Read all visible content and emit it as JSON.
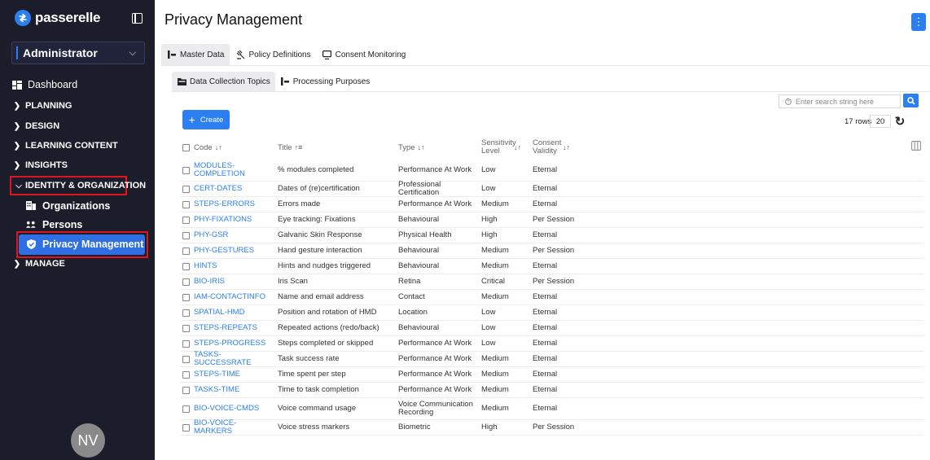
{
  "sidebar": {
    "brand": "passerelle",
    "role": "Administrator",
    "nav": {
      "dashboard": "Dashboard",
      "planning": "PLANNING",
      "design": "DESIGN",
      "learning_content": "LEARNING CONTENT",
      "insights": "INSIGHTS",
      "identity": "IDENTITY & ORGANIZATION",
      "organizations": "Organizations",
      "persons": "Persons",
      "privacy": "Privacy Management",
      "manage": "MANAGE"
    },
    "avatar_initials": "NV"
  },
  "header": {
    "title": "Privacy Management"
  },
  "tabs": [
    "Master Data",
    "Policy Definitions",
    "Consent Monitoring"
  ],
  "subtabs": [
    "Data Collection Topics",
    "Processing Purposes"
  ],
  "toolbar": {
    "search_placeholder": "Enter search string here",
    "create_label": "Create",
    "rows_label": "17 rows",
    "page_size": "20"
  },
  "table": {
    "columns": {
      "code": "Code",
      "title": "Title",
      "type": "Type",
      "sensitivity": "Sensitivity Level",
      "consent": "Consent Validity"
    },
    "rows": [
      {
        "code": "MODULES-COMPLETION",
        "title": "% modules completed",
        "type": "Performance At Work",
        "sensitivity": "Low",
        "consent": "Eternal"
      },
      {
        "code": "CERT-DATES",
        "title": "Dates of (re)certification",
        "type": "Professional Certification",
        "sensitivity": "Low",
        "consent": "Eternal"
      },
      {
        "code": "STEPS-ERRORS",
        "title": "Errors made",
        "type": "Performance At Work",
        "sensitivity": "Medium",
        "consent": "Eternal"
      },
      {
        "code": "PHY-FIXATIONS",
        "title": "Eye tracking: Fixations",
        "type": "Behavioural",
        "sensitivity": "High",
        "consent": "Per Session"
      },
      {
        "code": "PHY-GSR",
        "title": "Galvanic Skin Response",
        "type": "Physical Health",
        "sensitivity": "High",
        "consent": "Eternal"
      },
      {
        "code": "PHY-GESTURES",
        "title": "Hand gesture interaction",
        "type": "Behavioural",
        "sensitivity": "Medium",
        "consent": "Per Session"
      },
      {
        "code": "HINTS",
        "title": "Hints and nudges triggered",
        "type": "Behavioural",
        "sensitivity": "Medium",
        "consent": "Eternal"
      },
      {
        "code": "BIO-IRIS",
        "title": "Iris Scan",
        "type": "Retina",
        "sensitivity": "Critical",
        "consent": "Per Session"
      },
      {
        "code": "IAM-CONTACTINFO",
        "title": "Name and email address",
        "type": "Contact",
        "sensitivity": "Medium",
        "consent": "Eternal"
      },
      {
        "code": "SPATIAL-HMD",
        "title": "Position and rotation of HMD",
        "type": "Location",
        "sensitivity": "Low",
        "consent": "Eternal"
      },
      {
        "code": "STEPS-REPEATS",
        "title": "Repeated actions (redo/back)",
        "type": "Behavioural",
        "sensitivity": "Low",
        "consent": "Eternal"
      },
      {
        "code": "STEPS-PROGRESS",
        "title": "Steps completed or skipped",
        "type": "Performance At Work",
        "sensitivity": "Low",
        "consent": "Eternal"
      },
      {
        "code": "TASKS-SUCCESSRATE",
        "title": "Task success rate",
        "type": "Performance At Work",
        "sensitivity": "Medium",
        "consent": "Eternal"
      },
      {
        "code": "STEPS-TIME",
        "title": "Time spent per step",
        "type": "Performance At Work",
        "sensitivity": "Medium",
        "consent": "Eternal"
      },
      {
        "code": "TASKS-TIME",
        "title": "Time to task completion",
        "type": "Performance At Work",
        "sensitivity": "Medium",
        "consent": "Eternal"
      },
      {
        "code": "BIO-VOICE-CMDS",
        "title": "Voice command usage",
        "type": "Voice Communication Recording",
        "sensitivity": "Medium",
        "consent": "Eternal"
      },
      {
        "code": "BIO-VOICE-MARKERS",
        "title": "Voice stress markers",
        "type": "Biometric",
        "sensitivity": "High",
        "consent": "Per Session"
      }
    ]
  }
}
